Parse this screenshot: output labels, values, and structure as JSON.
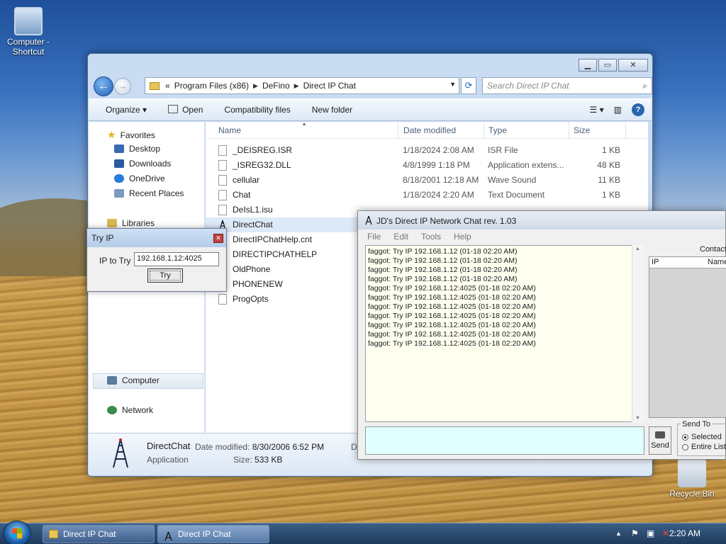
{
  "desktop": {
    "icons": [
      {
        "label": "Computer - Shortcut"
      },
      {
        "label": "Recycle Bin"
      }
    ]
  },
  "explorer": {
    "breadcrumb": [
      "«",
      "Program Files (x86)",
      "DeFino",
      "Direct IP Chat"
    ],
    "search_placeholder": "Search Direct IP Chat",
    "toolbar": {
      "organize": "Organize ▾",
      "open": "Open",
      "compat": "Compatibility files",
      "new_folder": "New folder"
    },
    "nav": {
      "favorites": "Favorites",
      "desktop": "Desktop",
      "downloads": "Downloads",
      "onedrive": "OneDrive",
      "recent": "Recent Places",
      "libraries": "Libraries",
      "computer": "Computer",
      "network": "Network"
    },
    "columns": {
      "name": "Name",
      "date": "Date modified",
      "type": "Type",
      "size": "Size"
    },
    "files": [
      {
        "name": "_DEISREG.ISR",
        "date": "1/18/2024 2:08 AM",
        "type": "ISR File",
        "size": "1 KB"
      },
      {
        "name": "_ISREG32.DLL",
        "date": "4/8/1999 1:18 PM",
        "type": "Application extens...",
        "size": "48 KB"
      },
      {
        "name": "cellular",
        "date": "8/18/2001 12:18 AM",
        "type": "Wave Sound",
        "size": "11 KB"
      },
      {
        "name": "Chat",
        "date": "1/18/2024 2:20 AM",
        "type": "Text Document",
        "size": "1 KB"
      },
      {
        "name": "DeIsL1.isu",
        "date": "",
        "type": "",
        "size": ""
      },
      {
        "name": "DirectChat",
        "date": "",
        "type": "",
        "size": ""
      },
      {
        "name": "DirectIPChatHelp.cnt",
        "date": "",
        "type": "",
        "size": ""
      },
      {
        "name": "DIRECTIPCHATHELP",
        "date": "",
        "type": "",
        "size": ""
      },
      {
        "name": "OldPhone",
        "date": "",
        "type": "",
        "size": ""
      },
      {
        "name": "PHONENEW",
        "date": "",
        "type": "",
        "size": ""
      },
      {
        "name": "ProgOpts",
        "date": "",
        "type": "",
        "size": ""
      }
    ],
    "details": {
      "name": "DirectChat",
      "kind": "Application",
      "date_label": "Date modified:",
      "date_value": "8/30/2006 6:52 PM",
      "size_label": "Size:",
      "size_value": "533 KB",
      "extra": "D"
    }
  },
  "tryip": {
    "title": "Try IP",
    "label": "IP to Try",
    "value": "192.168.1.12:4025",
    "button": "Try"
  },
  "chat": {
    "title": "JD's Direct IP Network Chat rev. 1.03",
    "menu": [
      "File",
      "Edit",
      "Tools",
      "Help"
    ],
    "log": [
      "faggot: Try IP 192.168.1.12 (01-18 02:20 AM)",
      "faggot: Try IP 192.168.1.12 (01-18 02:20 AM)",
      "faggot: Try IP 192.168.1.12 (01-18 02:20 AM)",
      "faggot: Try IP 192.168.1.12 (01-18 02:20 AM)",
      "faggot: Try IP 192.168.1.12:4025 (01-18 02:20 AM)",
      "faggot: Try IP 192.168.1.12:4025 (01-18 02:20 AM)",
      "faggot: Try IP 192.168.1.12:4025 (01-18 02:20 AM)",
      "faggot: Try IP 192.168.1.12:4025 (01-18 02:20 AM)",
      "faggot: Try IP 192.168.1.12:4025 (01-18 02:20 AM)",
      "faggot: Try IP 192.168.1.12:4025 (01-18 02:20 AM)",
      "faggot: Try IP 192.168.1.12:4025 (01-18 02:20 AM)"
    ],
    "contacts_label": "Contact",
    "contacts_cols": [
      "IP",
      "Name"
    ],
    "send": "Send",
    "send_to": "Send To",
    "send_selected": "Selected",
    "send_entire": "Entire List"
  },
  "taskbar": {
    "buttons": [
      "Direct IP Chat",
      "Direct IP Chat"
    ],
    "clock": "2:20 AM"
  }
}
